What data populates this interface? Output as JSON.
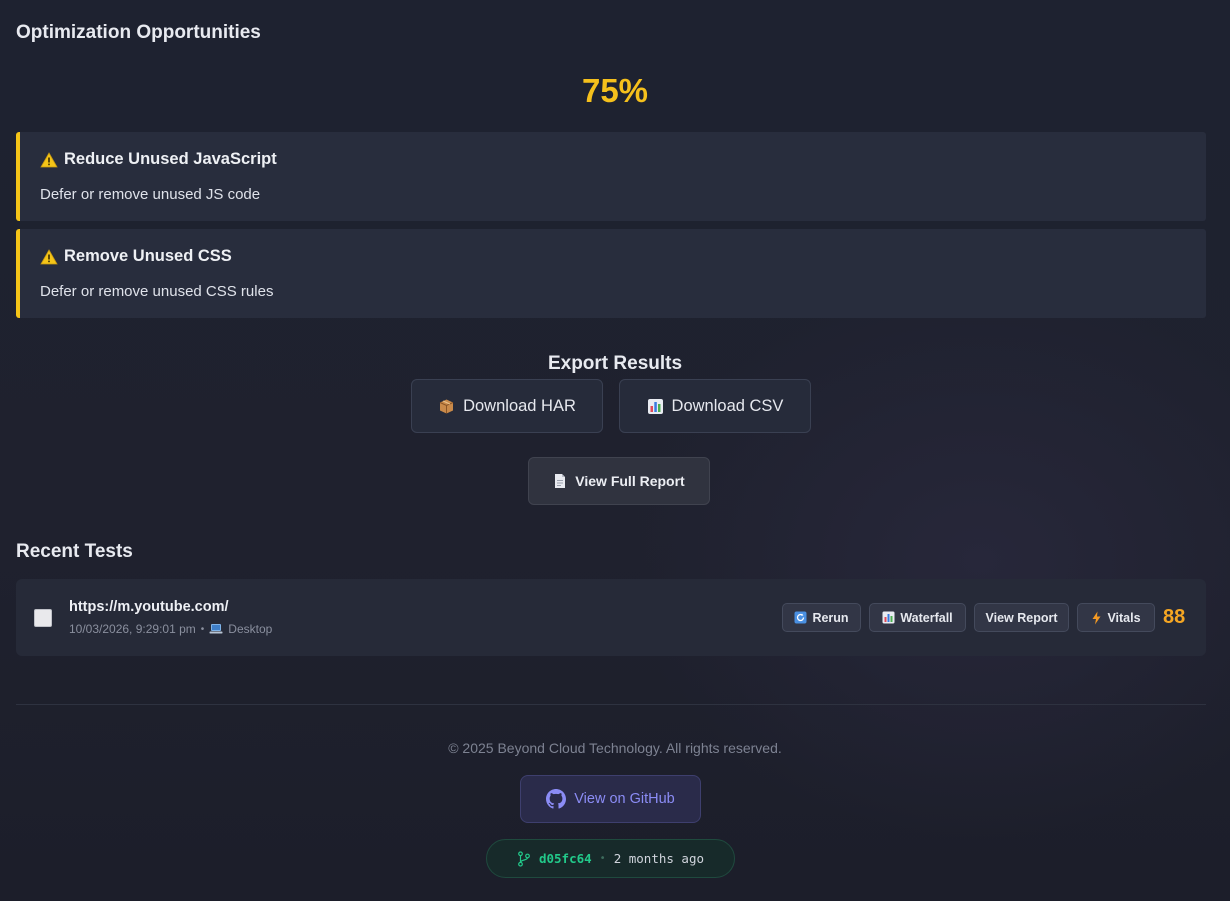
{
  "optimization": {
    "title": "Optimization Opportunities",
    "score": "75%",
    "items": [
      {
        "title": "Reduce Unused JavaScript",
        "description": "Defer or remove unused JS code"
      },
      {
        "title": "Remove Unused CSS",
        "description": "Defer or remove unused CSS rules"
      }
    ],
    "icon": "warning-icon",
    "accent_color": "#f5c518"
  },
  "export": {
    "title": "Export Results",
    "har_label": "Download HAR",
    "csv_label": "Download CSV",
    "report_label": "View Full Report"
  },
  "recent": {
    "title": "Recent Tests",
    "tests": [
      {
        "url": "https://m.youtube.com/",
        "timestamp": "10/03/2026, 9:29:01 pm",
        "device": "Desktop",
        "score": "88",
        "actions": {
          "rerun": "Rerun",
          "waterfall": "Waterfall",
          "view_report": "View Report",
          "vitals": "Vitals"
        }
      }
    ]
  },
  "footer": {
    "copyright": "© 2025 Beyond Cloud Technology. All rights reserved.",
    "github_label": "View on GitHub",
    "commit_hash": "d05fc64",
    "commit_age": "2 months ago"
  }
}
